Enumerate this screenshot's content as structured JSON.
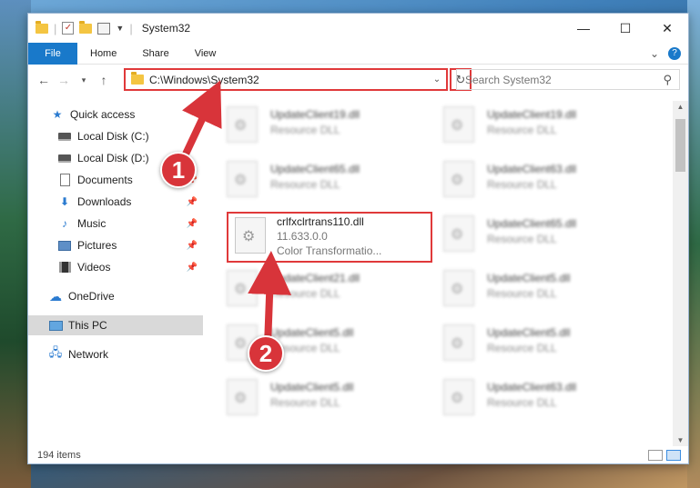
{
  "window": {
    "title": "System32",
    "controls": {
      "minimize": "—",
      "maximize": "☐",
      "close": "✕"
    }
  },
  "ribbon": {
    "file": "File",
    "tabs": [
      "Home",
      "Share",
      "View"
    ],
    "expand": "⌄",
    "help": "?"
  },
  "address": {
    "path": "C:\\Windows\\System32",
    "search_placeholder": "Search System32"
  },
  "sidebar": {
    "items": [
      {
        "label": "Quick access",
        "icon": "quick-access-star-icon"
      },
      {
        "label": "Local Disk (C:)",
        "icon": "drive-icon"
      },
      {
        "label": "Local Disk (D:)",
        "icon": "drive-icon"
      },
      {
        "label": "Documents",
        "icon": "documents-icon",
        "pinned": true
      },
      {
        "label": "Downloads",
        "icon": "downloads-icon",
        "pinned": true
      },
      {
        "label": "Music",
        "icon": "music-icon",
        "pinned": true
      },
      {
        "label": "Pictures",
        "icon": "pictures-icon",
        "pinned": true
      },
      {
        "label": "Videos",
        "icon": "videos-icon",
        "pinned": true
      },
      {
        "label": "OneDrive",
        "icon": "onedrive-icon"
      },
      {
        "label": "This PC",
        "icon": "this-pc-icon",
        "selected": true
      },
      {
        "label": "Network",
        "icon": "network-icon"
      }
    ]
  },
  "files": {
    "left": [
      {
        "name": "UpdateClient19.dll",
        "line2": "Resource DLL"
      },
      {
        "name": "UpdateClient65.dll",
        "line2": "Resource DLL"
      },
      {
        "name": "crlfxclrtrans110.dll",
        "line2": "11.633.0.0",
        "line3": "Color Transformatio..."
      },
      {
        "name": "UpdateClient21.dll",
        "line2": "Resource DLL"
      },
      {
        "name": "UpdateClient5.dll",
        "line2": "Resource DLL"
      },
      {
        "name": "UpdateClient5.dll",
        "line2": "Resource DLL"
      }
    ],
    "right": [
      {
        "name": "UpdateClient19.dll",
        "line2": "Resource DLL"
      },
      {
        "name": "UpdateClient63.dll",
        "line2": "Resource DLL"
      },
      {
        "name": "UpdateClient65.dll",
        "line2": "Resource DLL"
      },
      {
        "name": "UpdateClient5.dll",
        "line2": "Resource DLL"
      },
      {
        "name": "UpdateClient5.dll",
        "line2": "Resource DLL"
      },
      {
        "name": "UpdateClient63.dll",
        "line2": "Resource DLL"
      }
    ]
  },
  "status": {
    "item_count": "194 items"
  },
  "annotations": {
    "step1": "1",
    "step2": "2",
    "color": "#d8343a"
  }
}
